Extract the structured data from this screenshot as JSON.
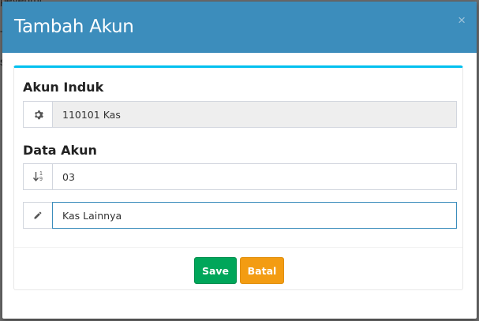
{
  "background": {
    "lines": [
      "pevenmi",
      "Ti",
      "s"
    ]
  },
  "modal": {
    "title": "Tambah Akun",
    "close_label": "×",
    "parent_section_label": "Akun Induk",
    "parent_account_value": "110101 Kas",
    "data_section_label": "Data Akun",
    "code_value": "03",
    "name_value": "Kas Lainnya",
    "save_label": "Save",
    "cancel_label": "Batal"
  },
  "icons": {
    "parent": "gear-icon",
    "code": "sort-numeric-icon",
    "name": "pencil-icon"
  },
  "colors": {
    "header": "#3c8dbc",
    "box_top_border": "#00c0ef",
    "save": "#00a65a",
    "cancel": "#f39c12"
  }
}
